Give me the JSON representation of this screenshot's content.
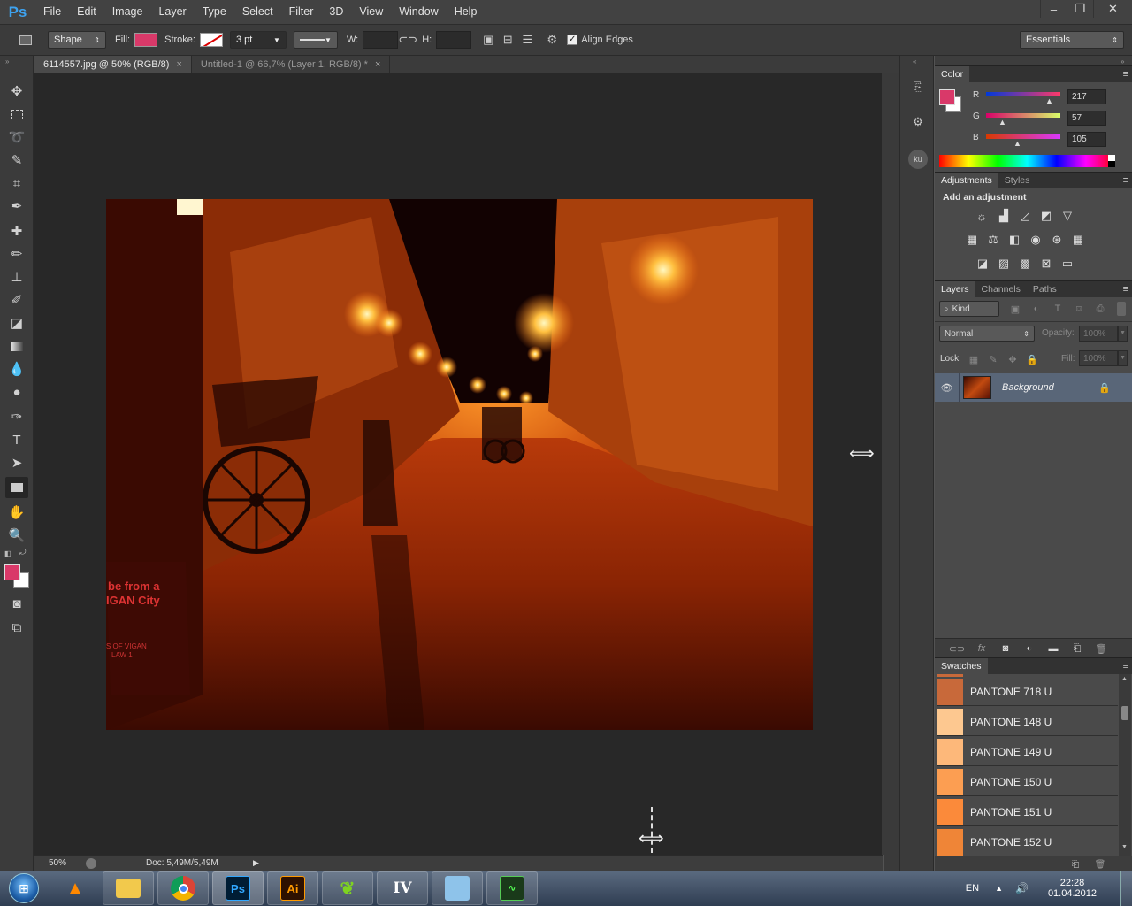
{
  "app": {
    "logo": "Ps"
  },
  "menu": [
    "File",
    "Edit",
    "Image",
    "Layer",
    "Type",
    "Select",
    "Filter",
    "3D",
    "View",
    "Window",
    "Help"
  ],
  "window_controls": {
    "minimize": "–",
    "restore": "❐",
    "close": "✕"
  },
  "options": {
    "tool_mode": "Shape",
    "fill_label": "Fill:",
    "fill_color": "#d93969",
    "stroke_label": "Stroke:",
    "stroke_width": "3 pt",
    "w_label": "W:",
    "h_label": "H:",
    "align_edges_label": "Align Edges",
    "align_edges_checked": true,
    "workspace": "Essentials"
  },
  "tabs": [
    {
      "label": "6114557.jpg @ 50% (RGB/8)",
      "close": "×",
      "active": true
    },
    {
      "label": "Untitled-1 @ 66,7% (Layer 1, RGB/8) *",
      "close": "×",
      "active": false
    }
  ],
  "status": {
    "zoom": "50%",
    "doc": "Doc: 5,49M/5,49M"
  },
  "photo_text": {
    "line1": "be from a",
    "line2": "IGAN City",
    "line3": "S OF VIGAN",
    "line4": "LAW 1"
  },
  "color_panel": {
    "tab": "Color",
    "foreground": "#d93969",
    "background": "#ffffff",
    "channels": [
      {
        "label": "R",
        "value": "217"
      },
      {
        "label": "G",
        "value": "57"
      },
      {
        "label": "B",
        "value": "105"
      }
    ]
  },
  "adjustments_panel": {
    "tabs": [
      "Adjustments",
      "Styles"
    ],
    "title": "Add an adjustment"
  },
  "layers_panel": {
    "tabs": [
      "Layers",
      "Channels",
      "Paths"
    ],
    "kind_label": "Kind",
    "blend_mode": "Normal",
    "opacity_label": "Opacity:",
    "opacity_value": "100%",
    "lock_label": "Lock:",
    "fill_label": "Fill:",
    "fill_value": "100%",
    "layers": [
      {
        "name": "Background",
        "visible": true,
        "locked": true
      }
    ]
  },
  "swatches_panel": {
    "tab": "Swatches",
    "items": [
      {
        "name": "PANTONE 718 U",
        "color": "#c8693a"
      },
      {
        "name": "PANTONE 148 U",
        "color": "#fdc890"
      },
      {
        "name": "PANTONE 149 U",
        "color": "#fdb87a"
      },
      {
        "name": "PANTONE 150 U",
        "color": "#fc9e52"
      },
      {
        "name": "PANTONE 151 U",
        "color": "#fb8a3a"
      },
      {
        "name": "PANTONE 152 U",
        "color": "#ef8537"
      }
    ]
  },
  "taskbar": {
    "apps": [
      "Windows Explorer",
      "VLC",
      "Chrome",
      "Photoshop",
      "Illustrator",
      "Tool",
      "IrfanView",
      "Control Panel",
      "Task Manager"
    ],
    "lang": "EN",
    "time": "22:28",
    "date": "01.04.2012"
  }
}
